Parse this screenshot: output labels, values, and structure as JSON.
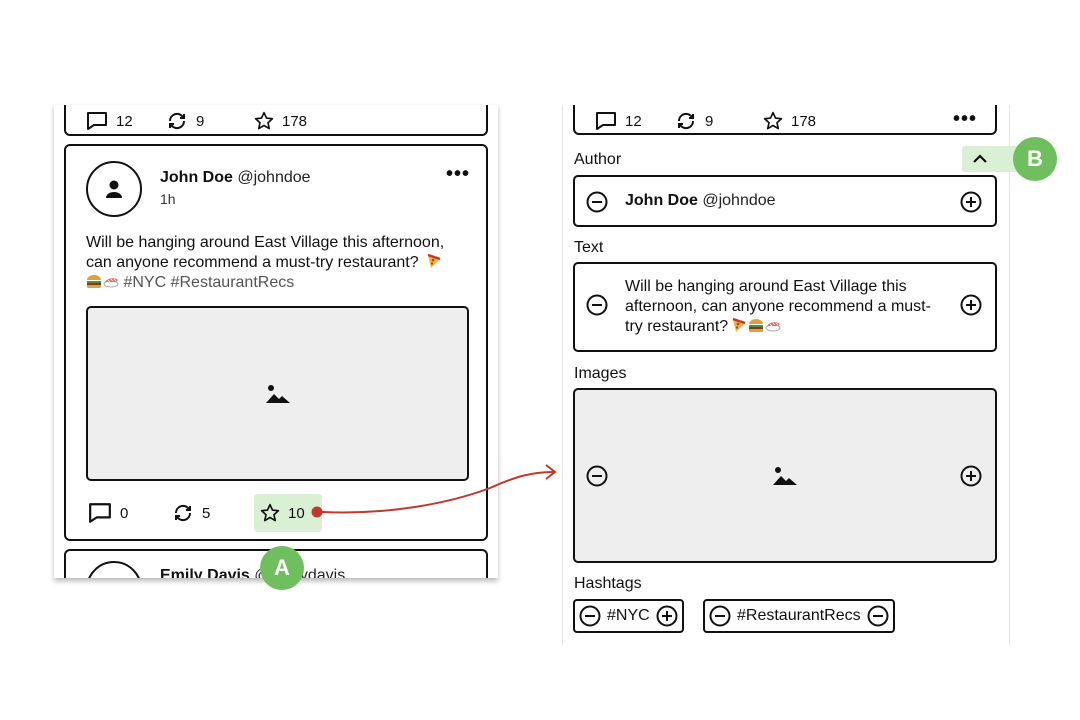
{
  "top_card_stats": {
    "comments": "12",
    "reposts": "9",
    "stars": "178"
  },
  "post": {
    "author_name": "John Doe",
    "author_handle": "@johndoe",
    "time": "1h",
    "text": "Will be hanging around East Village this afternoon, can anyone recommend a must-try restaurant?",
    "hashtags": [
      "#NYC",
      "#RestaurantRecs"
    ],
    "comments": "0",
    "reposts": "5",
    "stars": "10",
    "more_menu": "•••"
  },
  "next_post": {
    "author_name": "Emily Davis",
    "author_handle_partial": "@emilydavis"
  },
  "annotations": {
    "badge_a": "A",
    "badge_b": "B"
  },
  "editor": {
    "author_label": "Author",
    "author_name": "John Doe",
    "author_handle": "@johndoe",
    "text_label": "Text",
    "text_line1": "Will be hanging around East Village this",
    "text_line2": "afternoon, can anyone recommend a must-",
    "text_line3": "try restaurant?",
    "images_label": "Images",
    "hashtags_label": "Hashtags",
    "hashtags": [
      "#NYC",
      "#RestaurantRecs"
    ]
  },
  "colors": {
    "highlight": "#d9f0d4",
    "badge": "#6fbf5f",
    "arrow": "#c0392b",
    "image_fill": "#eeeeee"
  },
  "icons": [
    "comment-icon",
    "repost-icon",
    "star-icon",
    "person-icon",
    "image-icon",
    "minus-circle-icon",
    "plus-circle-icon",
    "chevron-up-icon",
    "more-icon"
  ]
}
